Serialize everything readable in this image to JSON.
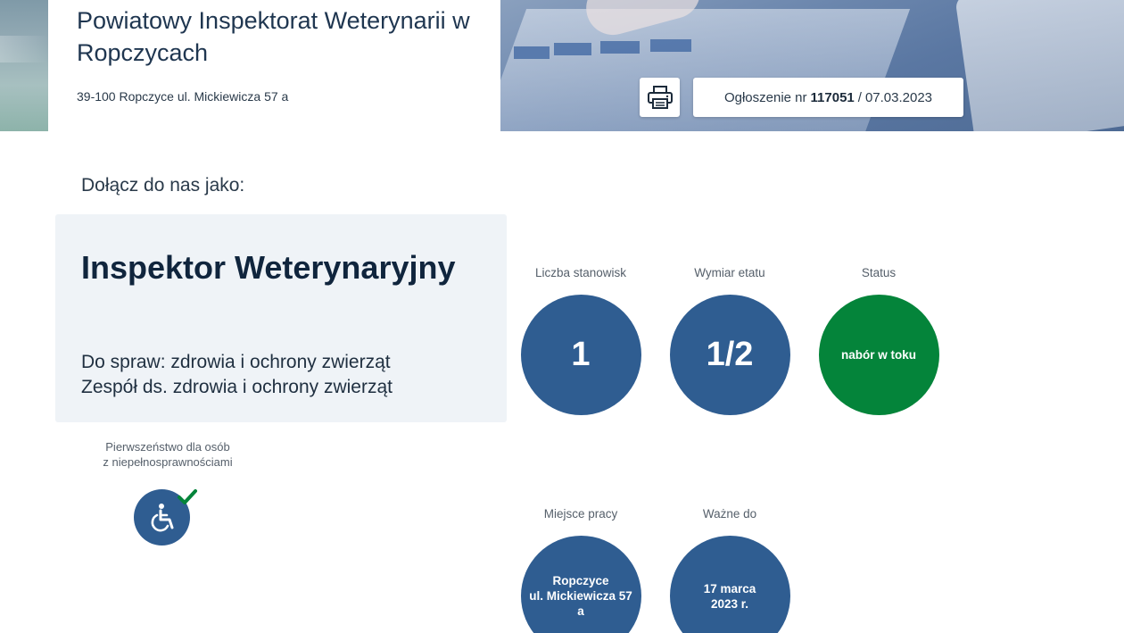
{
  "header": {
    "org_name": "Powiatowy Inspektorat Weterynarii w Ropczycach",
    "address": "39-100 Ropczyce ul. Mickiewicza 57 a",
    "announcement_prefix": "Ogłoszenie nr",
    "announcement_number": "117051",
    "announcement_separator": "/",
    "announcement_date": "07.03.2023",
    "print_icon": "printer-icon"
  },
  "join_label": "Dołącz do nas jako:",
  "job": {
    "title": "Inspektor Weterynaryjny",
    "dept_line1": "Do spraw: zdrowia i ochrony zwierząt",
    "dept_line2": "Zespół ds. zdrowia i ochrony zwierząt"
  },
  "priority": {
    "label_line1": "Pierwszeństwo dla osób",
    "label_line2": "z niepełnosprawnościami",
    "icon": "wheelchair-icon",
    "badge_icon": "check-icon"
  },
  "stats": {
    "positions": {
      "label": "Liczba stanowisk",
      "value": "1"
    },
    "fte": {
      "label": "Wymiar etatu",
      "value": "1/2"
    },
    "status": {
      "label": "Status",
      "value": "nabór w toku"
    },
    "workplace": {
      "label": "Miejsce pracy",
      "line1": "Ropczyce",
      "line2": "ul. Mickiewicza 57",
      "line3": "a"
    },
    "valid_until": {
      "label": "Ważne do",
      "line1": "17 marca",
      "line2": "2023 r."
    }
  },
  "colors": {
    "circle_blue": "#2f5d91",
    "circle_green": "#04843a",
    "card_bg": "#eff3f7"
  }
}
